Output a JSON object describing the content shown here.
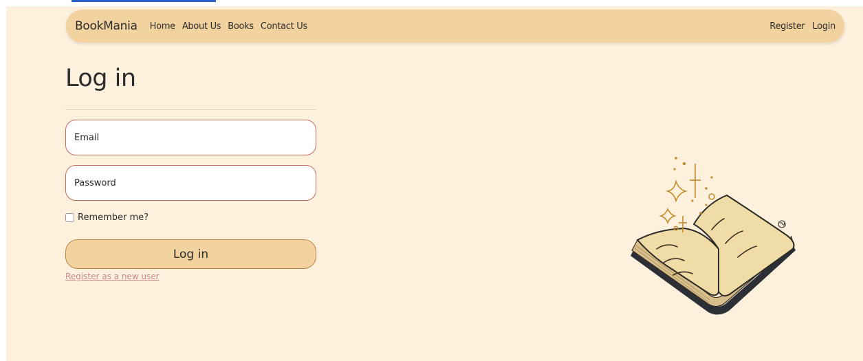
{
  "nav": {
    "brand": "BookMania",
    "links": [
      "Home",
      "About Us",
      "Books",
      "Contact Us"
    ],
    "right_links": [
      "Register",
      "Login"
    ]
  },
  "form": {
    "title": "Log in",
    "email_placeholder": "Email",
    "password_placeholder": "Password",
    "remember_label": "Remember me?",
    "remember_checked": false,
    "submit_label": "Log in",
    "register_link": "Register as a new user"
  },
  "colors": {
    "page_background": "#fdf1de",
    "navbar": "#f2d3a0",
    "field_border": "#c96a5a",
    "register_link": "#c9898a",
    "top_link_strip": "#2a5fc4"
  },
  "illustration": {
    "icon": "open-book-sparkles-icon"
  }
}
